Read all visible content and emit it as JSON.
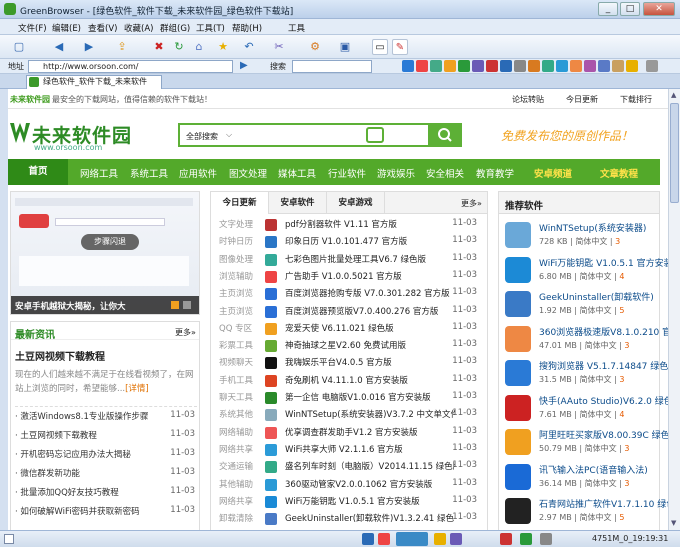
{
  "window": {
    "title": "GreenBrowser - [绿色软件_软件下载_未来软件园_绿色软件下载站]",
    "minimize": "_",
    "maximize": "□",
    "close": "✕"
  },
  "menu": [
    "文件(F)",
    "编辑(E)",
    "查看(V)",
    "收藏(A)",
    "群组(G)",
    "工具(T)",
    "帮助(H)"
  ],
  "toolbar": {
    "tools_label": "工具"
  },
  "address": {
    "label": "地址",
    "url": "http://www.orsoon.com/",
    "search_label": "搜索"
  },
  "tab": {
    "title": "绿色软件_软件下载_未来软件"
  },
  "site": {
    "top_left": "未来软件园",
    "top_tagline": "最安全的下载网站，值得信赖的软件下载站！",
    "top_links": [
      "论坛转贴",
      "今日更新",
      "下载排行"
    ],
    "brand": "未来软件园",
    "brand_url": "www.orsoon.com",
    "search_scope": "全部搜索",
    "slogan": "免费发布您的原创作品！",
    "nav": [
      "首页",
      "网络工具",
      "系统工具",
      "应用软件",
      "图文处理",
      "媒体工具",
      "行业软件",
      "游戏娱乐",
      "安全相关",
      "教育教学",
      "安卓频道",
      "文章教程"
    ],
    "banner_caption": "安卓手机越狱大揭秘，让你大",
    "banner_pill": "步骤闪退",
    "news": {
      "title": "最新资讯",
      "more": "更多»",
      "headline": "土豆网视频下载教程",
      "summary": "现在的人们越来越不满足于在线看视频了，在网站上浏览的同时，希望能够...",
      "detail": "[详情]",
      "items": [
        {
          "t": "激活Windows8.1专业版操作步骤",
          "d": "11-03"
        },
        {
          "t": "土豆网视频下载教程",
          "d": "11-03"
        },
        {
          "t": "开机密码忘记应用办法大揭秘",
          "d": "11-03"
        },
        {
          "t": "微信群发新功能",
          "d": "11-03"
        },
        {
          "t": "批量添加QQ好友技巧教程",
          "d": "11-03"
        },
        {
          "t": "如何破解WiFi密码并获取新密码",
          "d": "11-03"
        }
      ]
    },
    "mid": {
      "tabs": [
        "今日更新",
        "安卓软件",
        "安卓游戏"
      ],
      "more": "更多»",
      "rows": [
        {
          "c": "文字处理",
          "t": "pdf分割器软件 V1.11 官方版",
          "d": "11-03",
          "col": "#b33"
        },
        {
          "c": "时钟日历",
          "t": "印象日历 V1.0.101.477 官方版",
          "d": "11-03",
          "col": "#2a76c6"
        },
        {
          "c": "图像处理",
          "t": "七彩色图片批量处理工具V6.7 绿色版",
          "d": "11-03",
          "col": "#3a9"
        },
        {
          "c": "浏览辅助",
          "t": "广告助手 V1.0.0.5021 官方版",
          "d": "11-03",
          "col": "#e44"
        },
        {
          "c": "主页浏览",
          "t": "百度浏览器抢购专版 V7.0.301.282 官方版",
          "d": "11-03",
          "col": "#2a6fd6"
        },
        {
          "c": "主页浏览",
          "t": "百度浏览器预览版V7.0.400.276 官方版",
          "d": "11-03",
          "col": "#2a6fd6"
        },
        {
          "c": "QQ 专区",
          "t": "宠爱天使 V6.11.021 绿色版",
          "d": "11-03",
          "col": "#f0a020"
        },
        {
          "c": "彩票工具",
          "t": "神奇抽球之星V2.60 免费试用版",
          "d": "11-03",
          "col": "#6a3"
        },
        {
          "c": "视频聊天",
          "t": "我嗨娱乐平台V4.0.5 官方版",
          "d": "11-03",
          "col": "#111"
        },
        {
          "c": "手机工具",
          "t": "奇兔刷机 V4.11.1.0 官方安装版",
          "d": "11-03",
          "col": "#d42"
        },
        {
          "c": "聊天工具",
          "t": "第一企信 电脑版V1.0.016 官方安装版",
          "d": "11-03",
          "col": "#2a8a2a"
        },
        {
          "c": "系统其他",
          "t": "WinNTSetup(系统安装器)V3.7.2 中文单文件",
          "d": "11-03",
          "col": "#8ab"
        },
        {
          "c": "网络辅助",
          "t": "优享调查群发助手V1.2 官方安装版",
          "d": "11-03",
          "col": "#e55"
        },
        {
          "c": "网络共享",
          "t": "WiFi共享大师 V2.1.1.6 官方版",
          "d": "11-03",
          "col": "#2b9bd8"
        },
        {
          "c": "交通运输",
          "t": "盛名列车时刻（电脑版）V2014.11.15 绿色版",
          "d": "11-03",
          "col": "#3a8"
        },
        {
          "c": "其他辅助",
          "t": "360驱动管家V2.0.0.1062 官方安装版",
          "d": "11-03",
          "col": "#2a9ad6"
        },
        {
          "c": "网络共享",
          "t": "WiFi万能钥匙 V1.0.5.1 官方安装版",
          "d": "11-03",
          "col": "#1a8ad6"
        },
        {
          "c": "卸载清除",
          "t": "GeekUninstaller(卸载软件)V1.3.2.41 绿色",
          "d": "11-03",
          "col": "#4a7ac6"
        }
      ]
    },
    "recommend": {
      "title": "推荐软件",
      "items": [
        {
          "n": "WinNTSetup(系统安装器)",
          "s": "728 KB",
          "l": "简体中文",
          "r": "3",
          "col": "#6aa8d8"
        },
        {
          "n": "WiFi万能钥匙 V1.0.5.1 官方安装",
          "s": "6.80 MB",
          "l": "简体中文",
          "r": "4",
          "col": "#1c8ad6"
        },
        {
          "n": "GeekUninstaller(卸载软件)",
          "s": "1.92 MB",
          "l": "简体中文",
          "r": "5",
          "col": "#3a7ac6"
        },
        {
          "n": "360浏览器极速版V8.1.0.210 官",
          "s": "47.01 MB",
          "l": "简体中文",
          "r": "3",
          "col": "#e84"
        },
        {
          "n": "搜狗浏览器 V5.1.7.14847 绿色",
          "s": "31.5 MB",
          "l": "简体中文",
          "r": "3",
          "col": "#2a7ad6"
        },
        {
          "n": "快手(AAuto Studio)V6.2.0 绿色",
          "s": "7.61 MB",
          "l": "简体中文",
          "r": "4",
          "col": "#c22"
        },
        {
          "n": "阿里旺旺买家版V8.00.39C 绿色",
          "s": "50.79 MB",
          "l": "简体中文",
          "r": "3",
          "col": "#f0a020"
        },
        {
          "n": "讯飞输入法PC(语音输入法)",
          "s": "36.14 MB",
          "l": "简体中文",
          "r": "3",
          "col": "#1a6ad6"
        },
        {
          "n": "石青网站推广软件V1.7.1.10 绿色",
          "s": "2.97 MB",
          "l": "简体中文",
          "r": "5",
          "col": "#222"
        }
      ]
    }
  },
  "status": {
    "text": "4751M_0_19:19:31"
  }
}
